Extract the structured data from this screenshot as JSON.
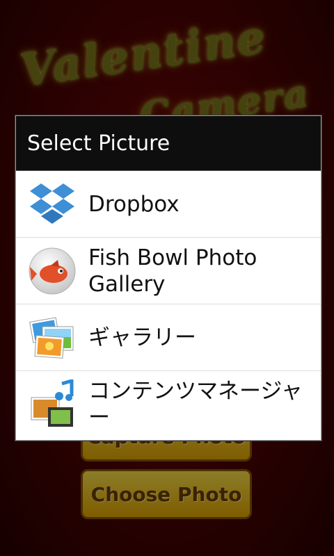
{
  "background": {
    "app_title_line1": "Valentine",
    "app_title_line2": "Camera",
    "capture_button": "Capture Photo",
    "choose_button": "Choose Photo"
  },
  "dialog": {
    "title": "Select Picture",
    "items": [
      {
        "label": "Dropbox",
        "icon": "dropbox-icon"
      },
      {
        "label": "Fish Bowl Photo Gallery",
        "icon": "fish-bowl-icon"
      },
      {
        "label": "ギャラリー",
        "icon": "gallery-icon"
      },
      {
        "label": "コンテンツマネージャー",
        "icon": "content-manager-icon"
      }
    ]
  },
  "colors": {
    "background": "#5a0404",
    "header": "#0e0e0e",
    "dropbox": "#3d8fd6",
    "button": "#f2c21a"
  }
}
